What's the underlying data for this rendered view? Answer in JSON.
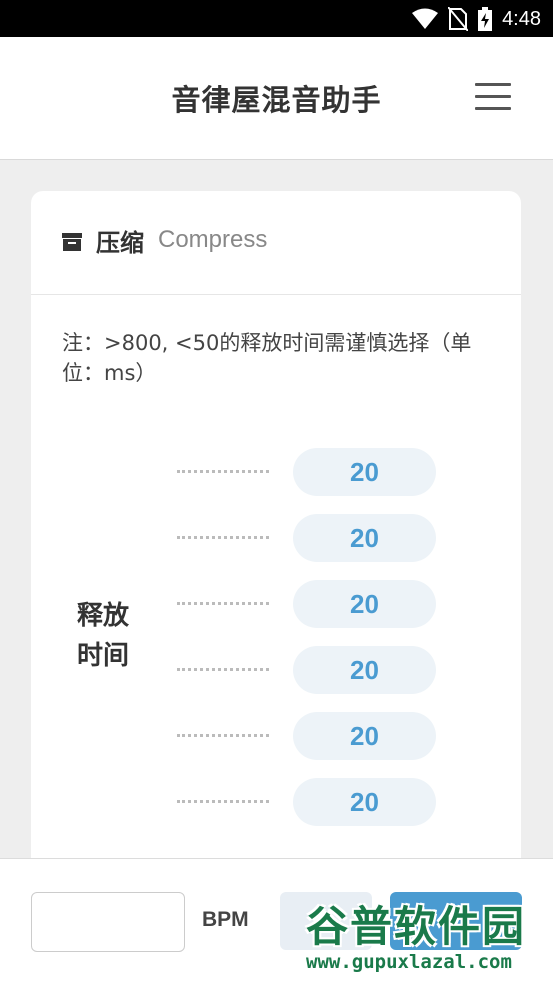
{
  "status_bar": {
    "time": "4:48",
    "icons": [
      "wifi-icon",
      "no-sim-icon",
      "battery-charging-icon"
    ]
  },
  "header": {
    "title": "音律屋混音助手",
    "menu_icon": "hamburger-menu-icon"
  },
  "card": {
    "icon": "archive-icon",
    "title": "压缩",
    "subtitle": "Compress",
    "note": "注：>800, <50的释放时间需谨慎选择（单位：ms）",
    "param_label": "释放时间",
    "values": [
      "20",
      "20",
      "20",
      "20",
      "20",
      "20"
    ]
  },
  "bottom_bar": {
    "bpm_value": "",
    "bpm_label": "BPM"
  },
  "watermark": {
    "text": "谷普软件园",
    "url": "www.gupuxlazal.com"
  },
  "colors": {
    "accent": "#4a9bd1",
    "field_bg": "#edf3f8",
    "page_bg": "#eeeeee",
    "watermark": "#1a7a4a"
  }
}
